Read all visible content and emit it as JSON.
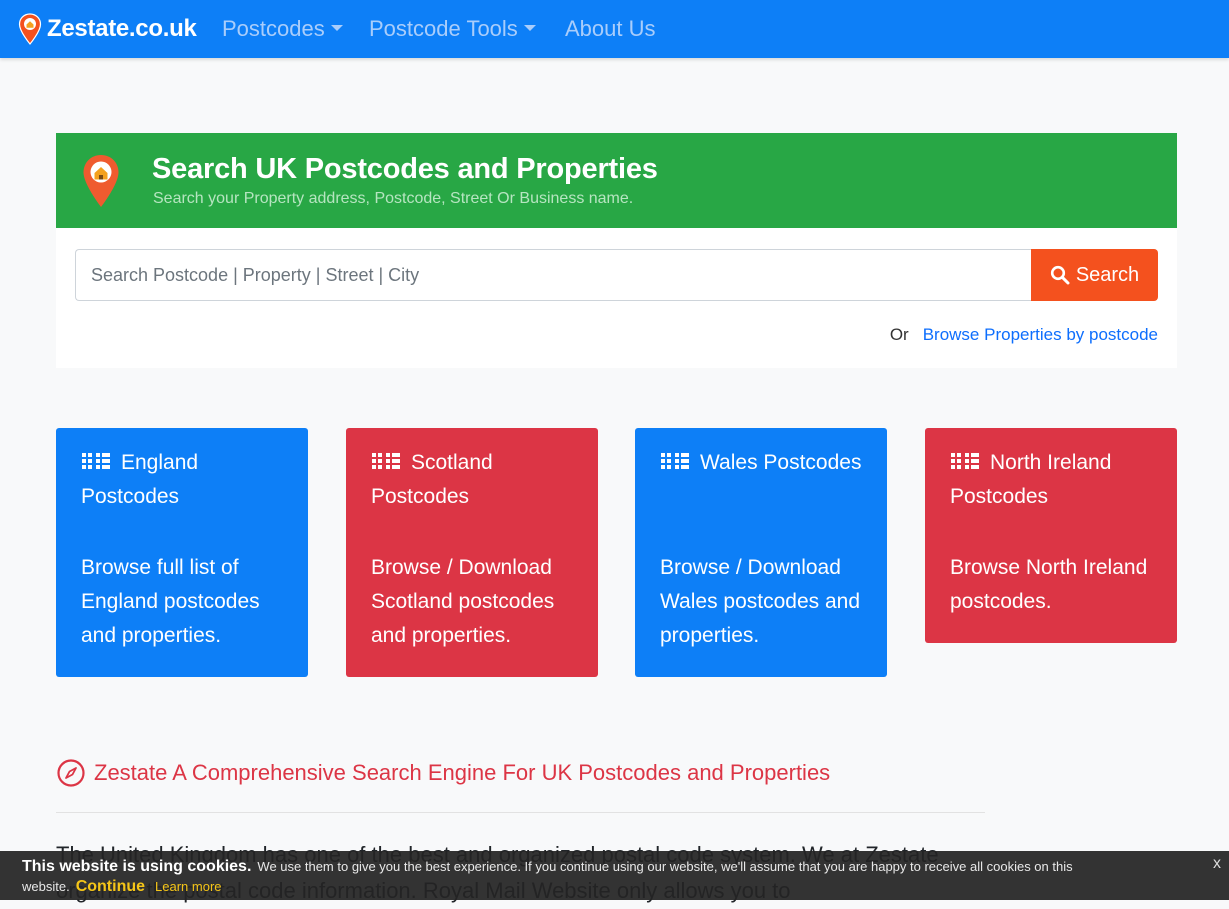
{
  "navbar": {
    "brand": "Zestate.co.uk",
    "links": [
      {
        "label": "Postcodes",
        "dropdown": true
      },
      {
        "label": "Postcode Tools",
        "dropdown": true
      },
      {
        "label": "About Us",
        "dropdown": false
      }
    ]
  },
  "hero": {
    "title": "Search UK Postcodes and Properties",
    "subtitle": "Search your Property address, Postcode, Street Or Business name."
  },
  "search": {
    "placeholder": "Search Postcode | Property | Street | City",
    "button_label": "Search",
    "or_text": "Or",
    "browse_link": "Browse Properties by postcode"
  },
  "cards": [
    {
      "title": "England Postcodes",
      "description": "Browse full list of England postcodes and properties.",
      "color": "#0d7ff7"
    },
    {
      "title": "Scotland Postcodes",
      "description": "Browse / Download Scotland postcodes and properties.",
      "color": "#dc3545"
    },
    {
      "title": "Wales Postcodes",
      "description": "Browse / Download Wales postcodes and properties.",
      "color": "#0d7ff7"
    },
    {
      "title": "North Ireland Postcodes",
      "description": "Browse North Ireland postcodes.",
      "color": "#dc3545"
    }
  ],
  "section": {
    "title": "Zestate A Comprehensive Search Engine For UK Postcodes and Properties",
    "body": "The United Kingdom has one of the best and organized postal code system. We at Zestate organize the postal code information. Royal Mail Website only allows you to"
  },
  "cookie": {
    "strong": "This website is using cookies.",
    "message": "We use them to give you the best experience. If you continue using our website, we'll assume that you are happy to receive all cookies on this",
    "message_end": "website.",
    "continue_label": "Continue",
    "learn_more_label": "Learn more",
    "close_label": "x"
  },
  "colors": {
    "navbar": "#0d7ff7",
    "hero": "#28a745",
    "search_button": "#f4511e",
    "blue_card": "#0d7ff7",
    "red_card": "#dc3545",
    "cookie_accent": "#f5c518"
  },
  "icons": {
    "brand": "map-pin-home-icon",
    "hero": "map-pin-home-icon",
    "search": "search-icon",
    "card": "grid-dots-icon",
    "section": "compass-icon"
  }
}
